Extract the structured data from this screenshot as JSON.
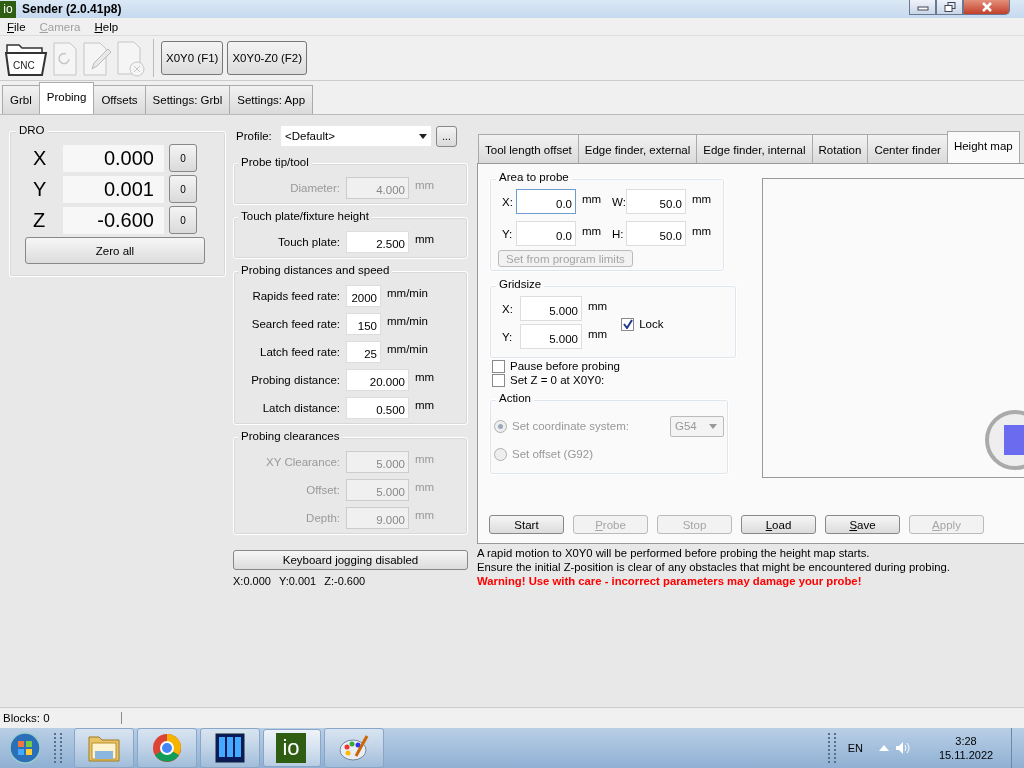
{
  "window": {
    "title": "Sender (2.0.41p8)",
    "app_icon_text": "io"
  },
  "menu": [
    {
      "label": "File",
      "disabled": false
    },
    {
      "label": "Camera",
      "disabled": true
    },
    {
      "label": "Help",
      "disabled": false
    }
  ],
  "toolbar": {
    "icons": [
      {
        "kind": "open",
        "label": "CNC",
        "disabled": false
      },
      {
        "kind": "reload",
        "disabled": true
      },
      {
        "kind": "edit",
        "disabled": true
      },
      {
        "kind": "close",
        "disabled": true
      }
    ],
    "buttons": [
      "X0Y0 (F1)",
      "X0Y0-Z0 (F2)"
    ]
  },
  "tabs": [
    {
      "label": "Grbl",
      "selected": false
    },
    {
      "label": "Probing",
      "selected": true
    },
    {
      "label": "Offsets",
      "selected": false
    },
    {
      "label": "Settings: Grbl",
      "selected": false
    },
    {
      "label": "Settings: App",
      "selected": false
    }
  ],
  "dro": {
    "title": "DRO",
    "axes": [
      {
        "axis": "X",
        "value": "0.000",
        "zero": "0"
      },
      {
        "axis": "Y",
        "value": "0.001",
        "zero": "0"
      },
      {
        "axis": "Z",
        "value": "-0.600",
        "zero": "0"
      }
    ],
    "zero_all": "Zero all"
  },
  "profile": {
    "label": "Profile:",
    "value": "<Default>",
    "more": "..."
  },
  "groups": [
    {
      "title": "Probe tip/tool",
      "disabled": true,
      "fields": [
        {
          "label": "Diameter:",
          "value": "4.000",
          "unit": "mm",
          "kind": "wide"
        }
      ]
    },
    {
      "title": "Touch plate/fixture height",
      "disabled": false,
      "fields": [
        {
          "label": "Touch plate:",
          "value": "2.500",
          "unit": "mm",
          "kind": "wide"
        }
      ]
    },
    {
      "title": "Probing distances and speed",
      "disabled": false,
      "fields": [
        {
          "label": "Rapids feed rate:",
          "value": "2000",
          "unit": "mm/min",
          "kind": "narrow"
        },
        {
          "label": "Search feed rate:",
          "value": "150",
          "unit": "mm/min",
          "kind": "narrow"
        },
        {
          "label": "Latch feed rate:",
          "value": "25",
          "unit": "mm/min",
          "kind": "narrow"
        },
        {
          "label": "Probing distance:",
          "value": "20.000",
          "unit": "mm",
          "kind": "wide"
        },
        {
          "label": "Latch distance:",
          "value": "0.500",
          "unit": "mm",
          "kind": "wide"
        }
      ]
    },
    {
      "title": "Probing clearances",
      "disabled": true,
      "fields": [
        {
          "label": "XY Clearance:",
          "value": "5.000",
          "unit": "mm",
          "kind": "wide"
        },
        {
          "label": "Offset:",
          "value": "5.000",
          "unit": "mm",
          "kind": "wide"
        },
        {
          "label": "Depth:",
          "value": "9.000",
          "unit": "mm",
          "kind": "wide"
        }
      ]
    }
  ],
  "keyboard_jogging": "Keyboard jogging disabled",
  "position": [
    "X:0.000",
    "Y:0.001",
    "Z:-0.600"
  ],
  "probe_tabs": [
    {
      "label": "Tool length offset",
      "selected": false
    },
    {
      "label": "Edge finder, external",
      "selected": false
    },
    {
      "label": "Edge finder, internal",
      "selected": false
    },
    {
      "label": "Rotation",
      "selected": false
    },
    {
      "label": "Center finder",
      "selected": false
    },
    {
      "label": "Height map",
      "selected": true
    }
  ],
  "area": {
    "title": "Area to probe",
    "fields": [
      {
        "label": "X:",
        "value": "0.0",
        "unit": "mm",
        "focused": true
      },
      {
        "label": "W:",
        "value": "50.0",
        "unit": "mm",
        "focused": false
      },
      {
        "label": "Y:",
        "value": "0.0",
        "unit": "mm",
        "focused": false
      },
      {
        "label": "H:",
        "value": "50.0",
        "unit": "mm",
        "focused": false
      }
    ],
    "limits_button": {
      "label": "Set from program limits",
      "disabled": true
    }
  },
  "gridsize": {
    "title": "Gridsize",
    "fields": [
      {
        "label": "X:",
        "value": "5.000",
        "unit": "mm"
      },
      {
        "label": "Y:",
        "value": "5.000",
        "unit": "mm"
      }
    ],
    "lock": {
      "label": "Lock",
      "checked": true
    }
  },
  "options": [
    {
      "label": "Pause before probing",
      "checked": false
    },
    {
      "label": "Set Z = 0 at X0Y0:",
      "checked": false
    }
  ],
  "action": {
    "title": "Action",
    "radios": [
      {
        "label": "Set coordinate system:",
        "selected": true,
        "disabled": true
      },
      {
        "label": "Set offset (G92)",
        "selected": false,
        "disabled": true
      }
    ],
    "select": {
      "value": "G54",
      "disabled": true
    }
  },
  "buttons": [
    {
      "label": "Start",
      "disabled": false,
      "mnemonic": false
    },
    {
      "label": "Probe",
      "disabled": true,
      "mnemonic": true
    },
    {
      "label": "Stop",
      "disabled": true,
      "mnemonic": false
    },
    {
      "label": "Load",
      "disabled": false,
      "mnemonic": true
    },
    {
      "label": "Save",
      "disabled": false,
      "mnemonic": true
    },
    {
      "label": "Apply",
      "disabled": true,
      "mnemonic": true
    }
  ],
  "info": [
    {
      "text": "A rapid motion to X0Y0 will be performed before probing the height map starts.",
      "kind": "note"
    },
    {
      "text": "Ensure the initial Z-position is clear of any obstacles that might be encountered during probing.",
      "kind": "note"
    },
    {
      "text": "Warning! Use with care - incorrect parameters may damage your probe!",
      "kind": "warning"
    }
  ],
  "status_bar": {
    "blocks": "Blocks: 0"
  },
  "taskbar": {
    "apps": [
      {
        "kind": "folder",
        "selected": false
      },
      {
        "kind": "browser",
        "selected": false
      },
      {
        "kind": "monitor",
        "selected": false
      },
      {
        "kind": "io",
        "text": "io",
        "selected": true
      },
      {
        "kind": "paint",
        "selected": false
      }
    ],
    "language": "EN",
    "time": "3:28",
    "date": "15.11.2022"
  }
}
